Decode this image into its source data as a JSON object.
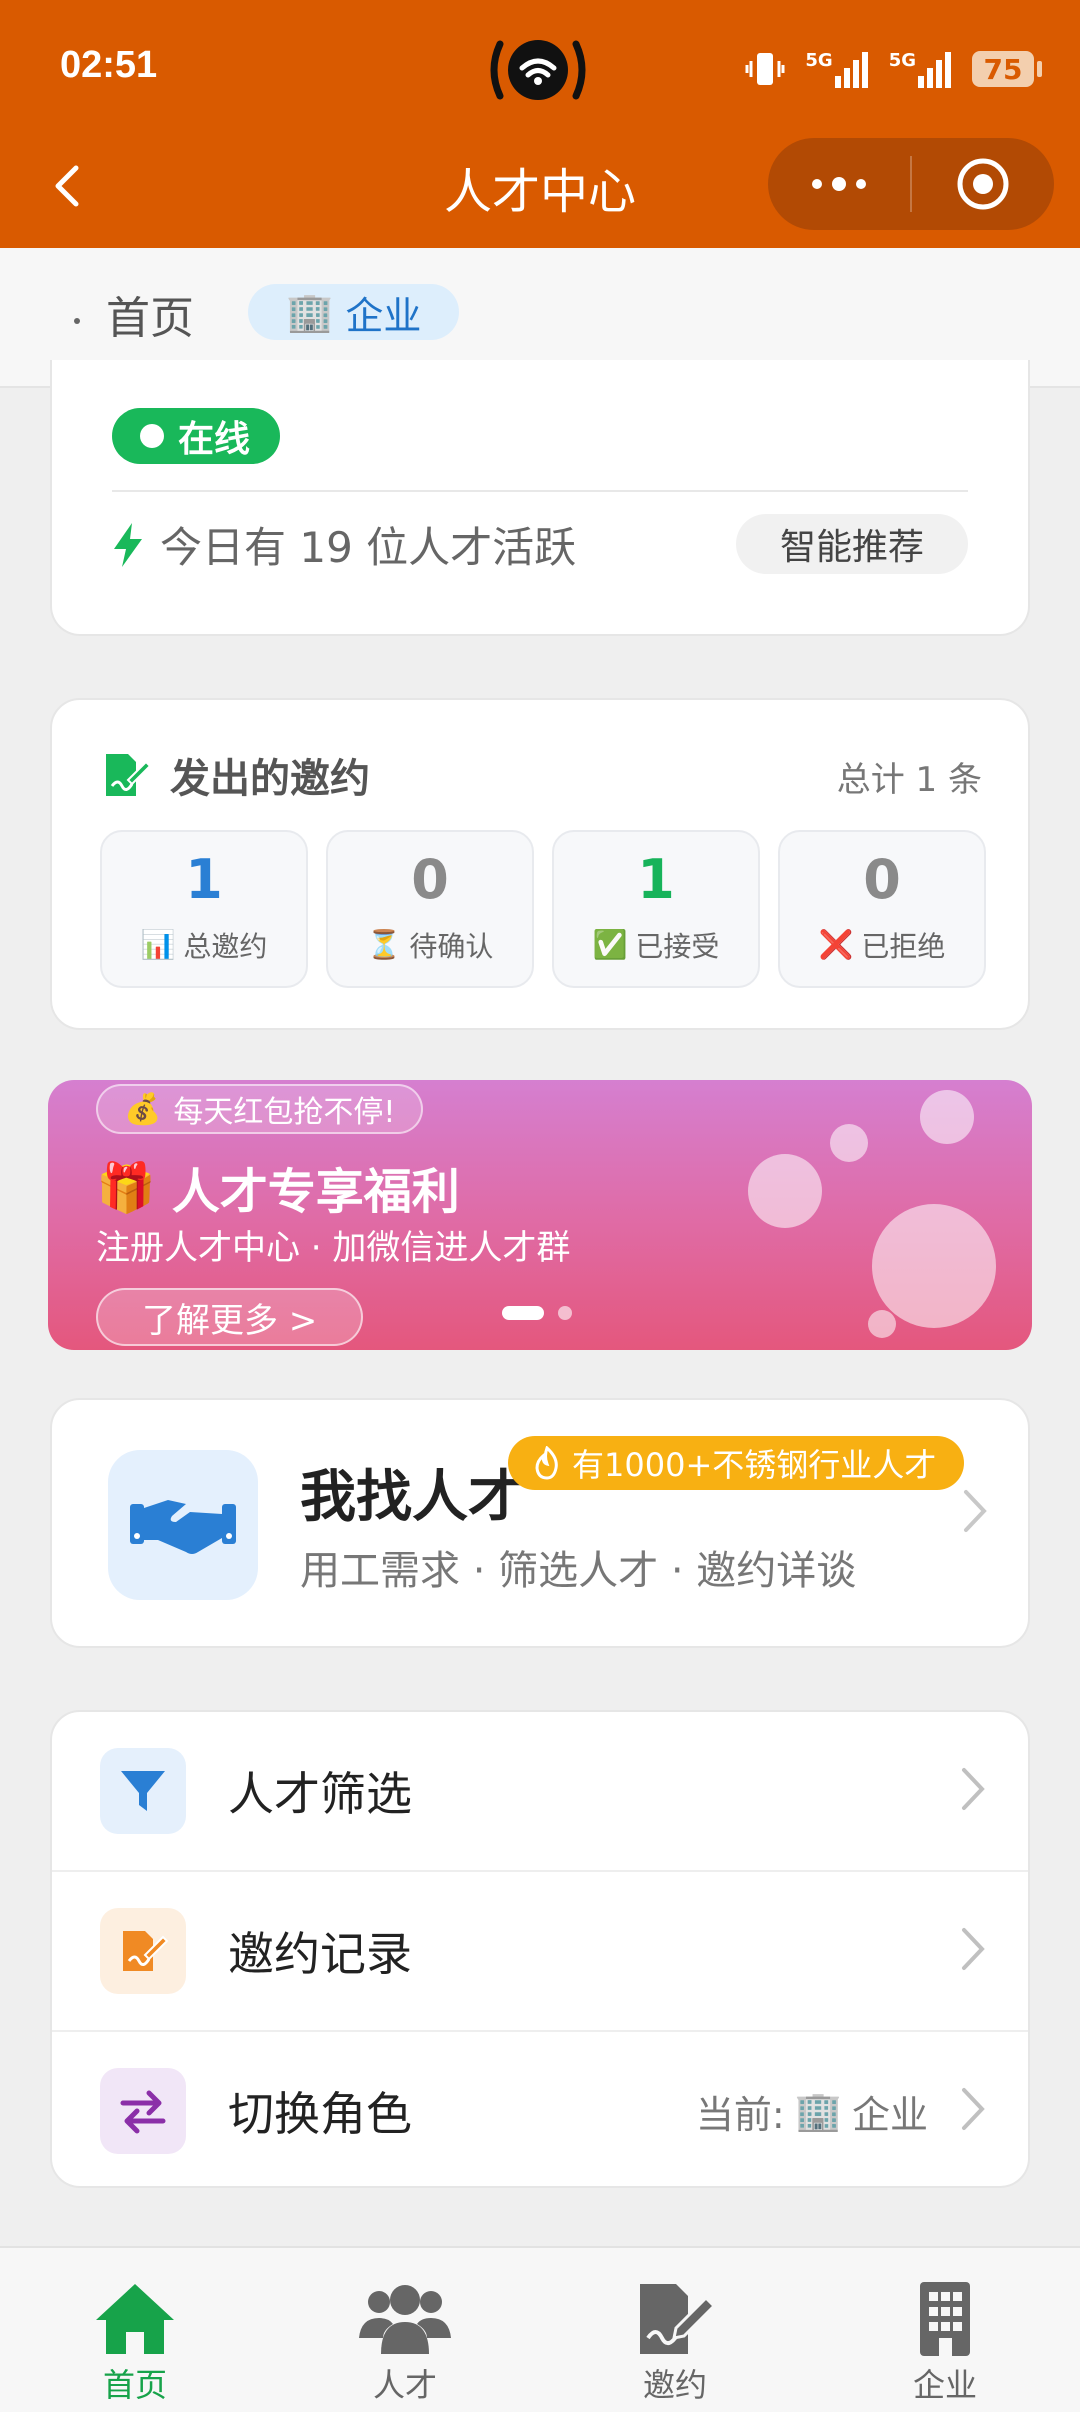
{
  "status_bar": {
    "time": "02:51",
    "battery": "75",
    "signal_labels": [
      "5G",
      "5G"
    ]
  },
  "navbar": {
    "title": "人才中心",
    "back_icon": "chevron-left-icon",
    "more_icon": "more-dots-icon",
    "close_icon": "target-circle-icon"
  },
  "breadcrumb": {
    "home": "首页",
    "current": "企业",
    "current_icon": "🏢"
  },
  "overview": {
    "online_label": "在线",
    "active_text": "今日有 19 位人才活跃",
    "smart_button": "智能推荐"
  },
  "invitations": {
    "title": "发出的邀约",
    "total": "总计 1 条",
    "stats": [
      {
        "value": "1",
        "label": "总邀约",
        "emoji": "📊",
        "color": "#2a7fd4"
      },
      {
        "value": "0",
        "label": "待确认",
        "emoji": "⏳",
        "color": "#8a8a8a"
      },
      {
        "value": "1",
        "label": "已接受",
        "emoji": "✅",
        "color": "#17b35a"
      },
      {
        "value": "0",
        "label": "已拒绝",
        "emoji": "❌",
        "color": "#8a8a8a"
      }
    ]
  },
  "banner": {
    "pill": "每天红包抢不停!",
    "pill_emoji": "💰",
    "title": "人才专享福利",
    "title_emoji": "🎁",
    "subtitle": "注册人才中心 · 加微信进人才群",
    "button": "了解更多 >"
  },
  "find_talent": {
    "title": "我找人才",
    "subtitle": "用工需求 · 筛选人才 · 邀约详谈",
    "badge": "有1000+不锈钢行业人才"
  },
  "menu": {
    "items": [
      {
        "label": "人才筛选",
        "icon": "filter-icon"
      },
      {
        "label": "邀约记录",
        "icon": "edit-document-icon"
      },
      {
        "label": "切换角色",
        "icon": "swap-arrows-icon",
        "value_prefix": "当前:",
        "value_emoji": "🏢",
        "value": "企业"
      }
    ]
  },
  "tabbar": {
    "tabs": [
      {
        "label": "首页",
        "icon": "home-icon",
        "active": true
      },
      {
        "label": "人才",
        "icon": "users-icon",
        "active": false
      },
      {
        "label": "邀约",
        "icon": "signature-icon",
        "active": false
      },
      {
        "label": "企业",
        "icon": "building-icon",
        "active": false
      }
    ]
  },
  "colors": {
    "brand_orange": "#d95a00",
    "green": "#19b85a",
    "blue": "#2a7fd4",
    "badge_yellow": "#f8b012"
  }
}
